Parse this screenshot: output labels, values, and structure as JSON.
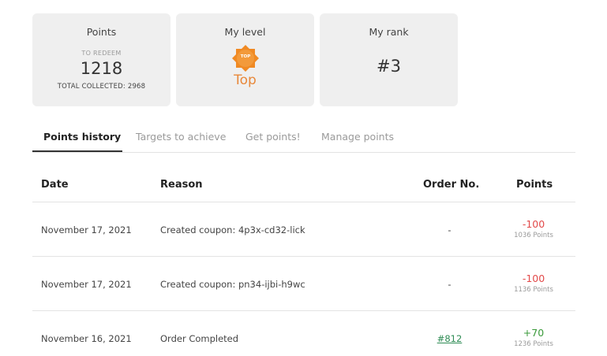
{
  "summary": {
    "points": {
      "title": "Points",
      "to_redeem_label": "TO REDEEM",
      "to_redeem_value": "1218",
      "total_collected_label": "TOTAL COLLECTED: 2968"
    },
    "level": {
      "title": "My level",
      "badge_text": "TOP",
      "level_name": "Top",
      "badge_color": "#f08a24"
    },
    "rank": {
      "title": "My rank",
      "value": "#3"
    }
  },
  "tabs": [
    {
      "label": "Points history",
      "active": true
    },
    {
      "label": "Targets to achieve",
      "active": false
    },
    {
      "label": "Get points!",
      "active": false
    },
    {
      "label": "Manage points",
      "active": false
    }
  ],
  "history": {
    "columns": {
      "date": "Date",
      "reason": "Reason",
      "order": "Order No.",
      "points": "Points"
    },
    "rows": [
      {
        "date": "November 17, 2021",
        "reason": "Created coupon: 4p3x-cd32-lick",
        "order": "-",
        "change": "-100",
        "total": "1036 Points"
      },
      {
        "date": "November 17, 2021",
        "reason": "Created coupon: pn34-ijbi-h9wc",
        "order": "-",
        "change": "-100",
        "total": "1136 Points"
      },
      {
        "date": "November 16, 2021",
        "reason": "Order Completed",
        "order": "#812",
        "change": "+70",
        "total": "1236 Points"
      }
    ]
  },
  "colors": {
    "negative": "#e24a4a",
    "positive": "#3a9a3a",
    "link": "#2f8c55",
    "level_accent": "#e8883a"
  }
}
